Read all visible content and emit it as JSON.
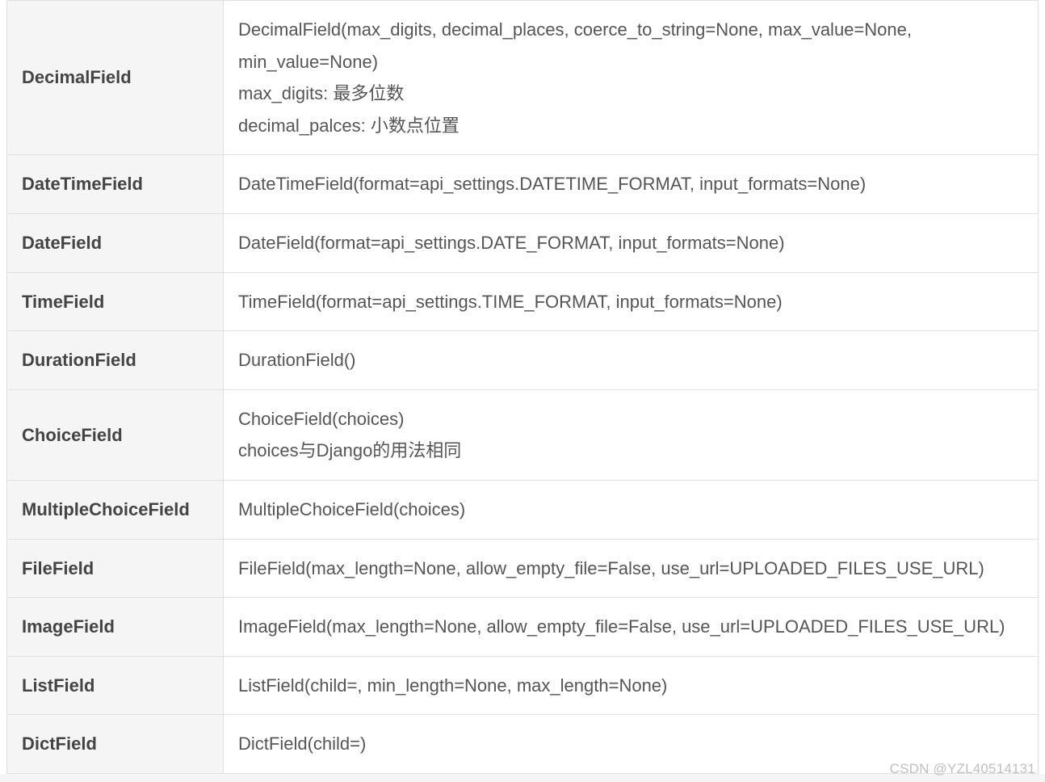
{
  "rows": [
    {
      "name": "DecimalField",
      "desc": "DecimalField(max_digits, decimal_places, coerce_to_string=None, max_value=None, min_value=None)\nmax_digits: 最多位数\ndecimal_palces: 小数点位置"
    },
    {
      "name": "DateTimeField",
      "desc": "DateTimeField(format=api_settings.DATETIME_FORMAT, input_formats=None)"
    },
    {
      "name": "DateField",
      "desc": "DateField(format=api_settings.DATE_FORMAT, input_formats=None)"
    },
    {
      "name": "TimeField",
      "desc": "TimeField(format=api_settings.TIME_FORMAT, input_formats=None)"
    },
    {
      "name": "DurationField",
      "desc": "DurationField()"
    },
    {
      "name": "ChoiceField",
      "desc": "ChoiceField(choices)\nchoices与Django的用法相同"
    },
    {
      "name": "MultipleChoiceField",
      "desc": "MultipleChoiceField(choices)"
    },
    {
      "name": "FileField",
      "desc": "FileField(max_length=None, allow_empty_file=False, use_url=UPLOADED_FILES_USE_URL)"
    },
    {
      "name": "ImageField",
      "desc": "ImageField(max_length=None, allow_empty_file=False, use_url=UPLOADED_FILES_USE_URL)"
    },
    {
      "name": "ListField",
      "desc": "ListField(child=, min_length=None, max_length=None)"
    },
    {
      "name": "DictField",
      "desc": "DictField(child=)"
    }
  ],
  "watermark": "CSDN @YZL40514131"
}
